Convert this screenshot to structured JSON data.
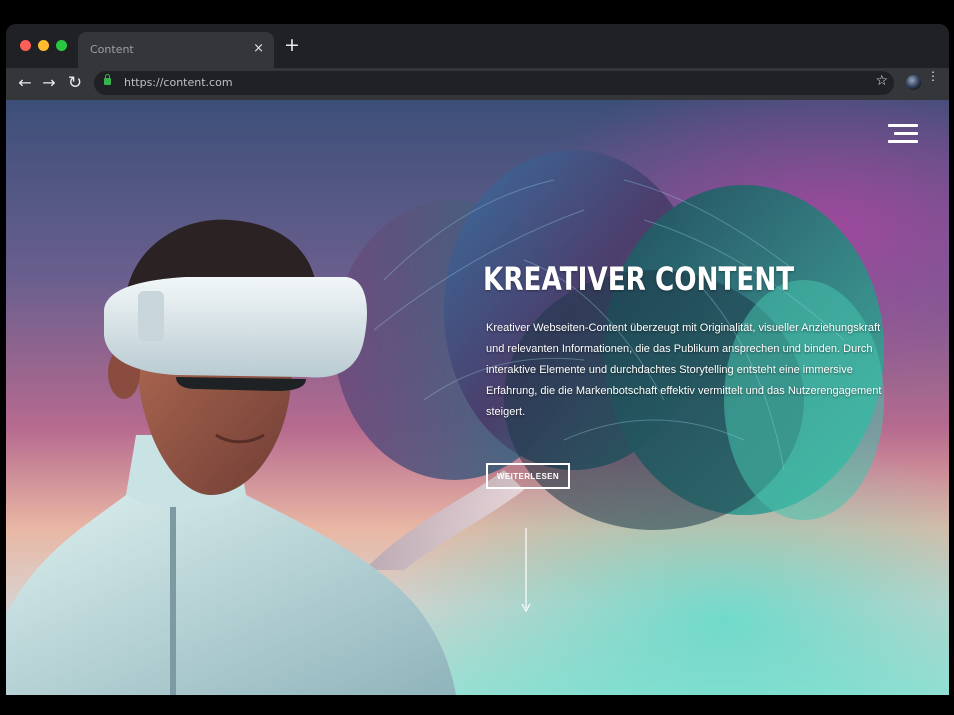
{
  "browser": {
    "traffic_lights": {
      "close": "#ff5f57",
      "minimize": "#febc2e",
      "maximize": "#28c840"
    },
    "tab": {
      "title": "Content",
      "close_glyph": "×"
    },
    "new_tab_glyph": "+",
    "nav": {
      "back_glyph": "←",
      "forward_glyph": "→",
      "reload_glyph": "↻"
    },
    "address_bar": {
      "url": "https://content.com"
    },
    "bookmark_glyph": "☆",
    "menu_glyph": "⋮"
  },
  "page": {
    "hero": {
      "title": "KREATIVER CONTENT",
      "body": "Kreativer Webseiten-Content überzeugt mit Originalität, visueller Anziehungskraft und relevanten Informationen, die das Publikum ansprechen und binden. Durch interaktive Elemente und durchdachtes Storytelling entsteht eine immersive Erfahrung, die die Markenbotschaft effektiv vermittelt und das Nutzerengagement steigert.",
      "cta_label": "WEITERLESEN"
    },
    "icons": {
      "menu": "hamburger-menu-icon",
      "scroll": "arrow-down-icon"
    },
    "colors": {
      "accent": "#ffffff",
      "browser_dark": "#202124",
      "browser_mid": "#35363a"
    }
  }
}
